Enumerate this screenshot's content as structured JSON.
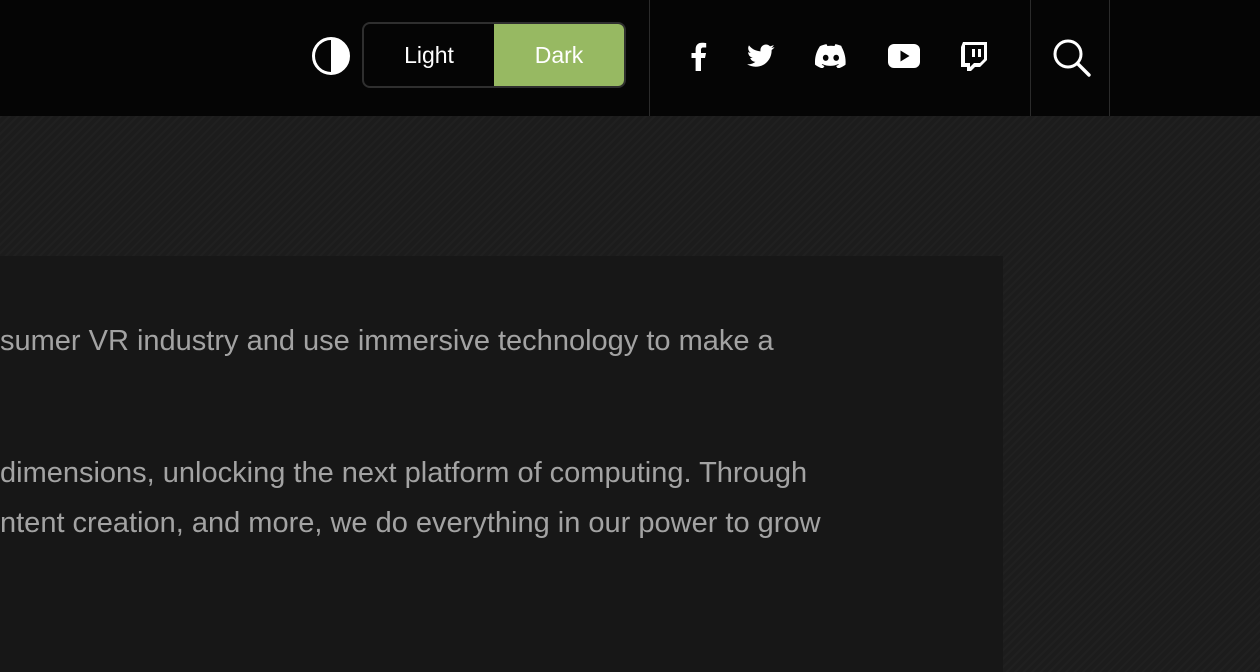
{
  "header": {
    "theme_toggle": {
      "icon": "contrast-icon",
      "light_label": "Light",
      "dark_label": "Dark",
      "selected": "Dark",
      "accent_color": "#97b962"
    },
    "social_links": [
      {
        "name": "facebook",
        "icon": "facebook-icon"
      },
      {
        "name": "twitter",
        "icon": "twitter-icon"
      },
      {
        "name": "discord",
        "icon": "discord-icon"
      },
      {
        "name": "youtube",
        "icon": "youtube-icon"
      },
      {
        "name": "twitch",
        "icon": "twitch-icon"
      }
    ],
    "search_icon": "search-icon"
  },
  "content": {
    "paragraph_1_line_1": "sumer VR industry and use immersive technology to make a",
    "paragraph_2_line_1": "dimensions, unlocking the next platform of computing. Through",
    "paragraph_2_line_2": "ntent creation, and more, we do everything in our power to grow"
  }
}
